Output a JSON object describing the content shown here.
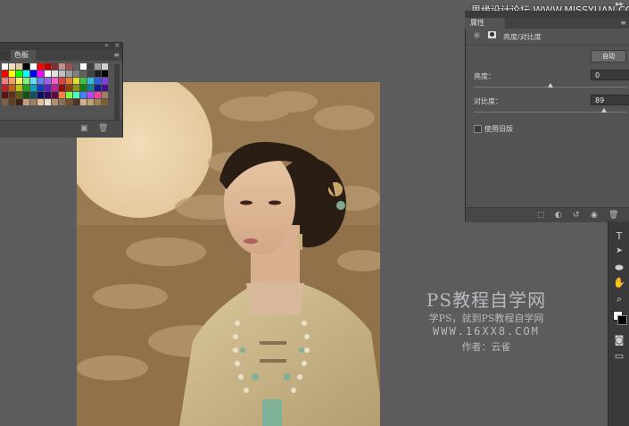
{
  "site_watermark": "思缘设计论坛  WWW.MISSYUAN.COM",
  "swatches_panel": {
    "collapse_icon": "double-chevron-left",
    "close_icon": "close",
    "tab_label": "色板",
    "panel_menu_icon": "hamburger",
    "swatch_colors": [
      "#ffffff",
      "#f0e0c0",
      "#e0c8a0",
      "#000000",
      "#ffffff",
      "#ff0000",
      "#c00000",
      "#803030",
      "#c09090",
      "#a05050",
      "#606060",
      "#ffffff",
      "#404040",
      "#a0a0a0",
      "#d0d0d0",
      "#ff0000",
      "#ffff00",
      "#00ff00",
      "#00ffff",
      "#0000ff",
      "#ff00ff",
      "#ffffff",
      "#e0e0e0",
      "#c0c0c0",
      "#a0a0a0",
      "#808080",
      "#606060",
      "#404040",
      "#202020",
      "#000000",
      "#f08080",
      "#f0a060",
      "#f0f060",
      "#80f080",
      "#60e0f0",
      "#6080f0",
      "#a060f0",
      "#f060c0",
      "#e04040",
      "#e08030",
      "#e0e030",
      "#40c040",
      "#30c0e0",
      "#3060e0",
      "#8040e0",
      "#c02020",
      "#c06010",
      "#c0c010",
      "#20a020",
      "#10a0c0",
      "#1040c0",
      "#6020c0",
      "#c02090",
      "#901010",
      "#904010",
      "#909010",
      "#108010",
      "#108090",
      "#102090",
      "#401090",
      "#601010",
      "#603010",
      "#606010",
      "#105010",
      "#105060",
      "#101060",
      "#300860",
      "#600840",
      "#ff8040",
      "#80ff40",
      "#40ffc0",
      "#4080ff",
      "#c040ff",
      "#ff40a0",
      "#a08060",
      "#806040",
      "#604020",
      "#402010",
      "#c0a080",
      "#a08060",
      "#e0c0a0",
      "#f0e0d0",
      "#b09070",
      "#907050",
      "#705030",
      "#503020",
      "#d0b090",
      "#c0a070",
      "#a08050",
      "#806030"
    ],
    "footer_icons": [
      "new-swatch",
      "trash"
    ]
  },
  "properties_panel": {
    "tab_label": "属性",
    "panel_menu_icon": "hamburger",
    "header_icons": [
      "brightness-contrast-adjustment",
      "layer-mask"
    ],
    "title": "亮度/对比度",
    "auto_button": "自动",
    "brightness_label": "亮度：",
    "brightness_value": "0",
    "brightness_level": 0.5,
    "contrast_label": "对比度：",
    "contrast_value": "89",
    "contrast_level": 0.85,
    "legacy_label": "使用旧版",
    "legacy_checked": false,
    "footer_icons": [
      "clip-to-layer",
      "view-previous-state",
      "reset",
      "toggle-visibility",
      "trash"
    ]
  },
  "toolbar": {
    "tools": [
      {
        "name": "expand-arrows-icon",
        "glyph": "▸▸"
      },
      {
        "name": "type-tool-icon",
        "glyph": "T"
      },
      {
        "name": "path-selection-icon",
        "glyph": "▶"
      },
      {
        "name": "ellipse-tool-icon",
        "glyph": "⬬"
      },
      {
        "name": "hand-tool-icon",
        "glyph": "✋"
      },
      {
        "name": "zoom-tool-icon",
        "glyph": "🔍"
      },
      {
        "name": "color-swatches-icon",
        "glyph": "■"
      },
      {
        "name": "quick-mask-icon",
        "glyph": "◘"
      },
      {
        "name": "screen-mode-icon",
        "glyph": "▭"
      }
    ]
  },
  "watermark": {
    "line1": "PS教程自学网",
    "line2": "学PS，就到PS教程自学网",
    "line3": "WWW.16XX8.COM",
    "line4": "作者：云雀"
  }
}
